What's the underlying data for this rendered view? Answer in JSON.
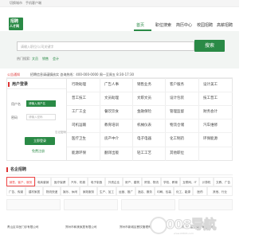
{
  "topbar": {
    "left": "切换城市",
    "right": "手机客户端"
  },
  "logo": {
    "line1": "招聘",
    "line2": "人才网"
  },
  "nav": {
    "items": [
      "首页",
      "职位搜索",
      "简历中心",
      "校园招聘",
      "高薪招聘"
    ],
    "active_index": 0
  },
  "search": {
    "placeholder": "请输入职位/公司关键字",
    "button": "搜索",
    "hot_label": "热门搜索:",
    "hot_terms": [
      "文员",
      "销售",
      "会计"
    ]
  },
  "notice": {
    "title": "公告通知",
    "text": "招聘信息请谨慎核实 咨询热线：400-000-0000 周一至周五 8:30-17:30"
  },
  "login": {
    "title": "用户登录",
    "username_label": "用户名",
    "username_placeholder": "请输入用户名",
    "password_label": "密码",
    "password_placeholder": "请输入密码",
    "forgot": "忘记密码",
    "button": "立即登录",
    "register": "免费注册"
  },
  "categories": [
    [
      "行政助理",
      "广告人事",
      "销售业务",
      "客户服务",
      "设计美工"
    ],
    [
      "普工技工",
      "文员助理",
      "文职文员",
      "设计包装",
      "技工普工"
    ],
    [
      "工厂工业",
      "餐饮饮食",
      "金融保险",
      "管理监督",
      "财务会计"
    ],
    [
      "司机运输",
      "教育培训",
      "机械仪表",
      "物流仓储",
      "汽车维修"
    ],
    [
      "医疗卫生",
      "房产中介",
      "电子电器",
      "化工制药",
      "环保能源"
    ],
    [
      "能源环保",
      "翻译出版",
      "轻工工艺",
      "其他职位",
      ""
    ]
  ],
  "famous": {
    "title": "名企招聘"
  },
  "tags": {
    "row1": [
      "销售、客户、服务",
      "电商营销",
      "医疗保健",
      "汽车、机械",
      "电子制造",
      "外资企业",
      "房产、建筑",
      "贸易、物流",
      "学校、教育",
      "互联网、IT",
      "计算机",
      "文教、广告"
    ],
    "row2": [
      "广告、传媒",
      "建材家居",
      "物流快递",
      "娱乐、休闲",
      "家政服务",
      "生产、加工",
      "运营、推广",
      "酒店、服务",
      "印刷、包装",
      "化工、能源",
      "医药",
      "其他、行业"
    ]
  },
  "companies": [
    "青山区中医门诊有限公司",
    "郑州市和美家居有限公司",
    "郑州市新城区餐饮管理有限公司",
    "郑州市金盛商贸有限公司"
  ],
  "watermark": {
    "text": "008导航",
    "sub": "www.008dh.com"
  },
  "colors": {
    "brand": "#2a8a46",
    "accent_red": "#d33"
  }
}
